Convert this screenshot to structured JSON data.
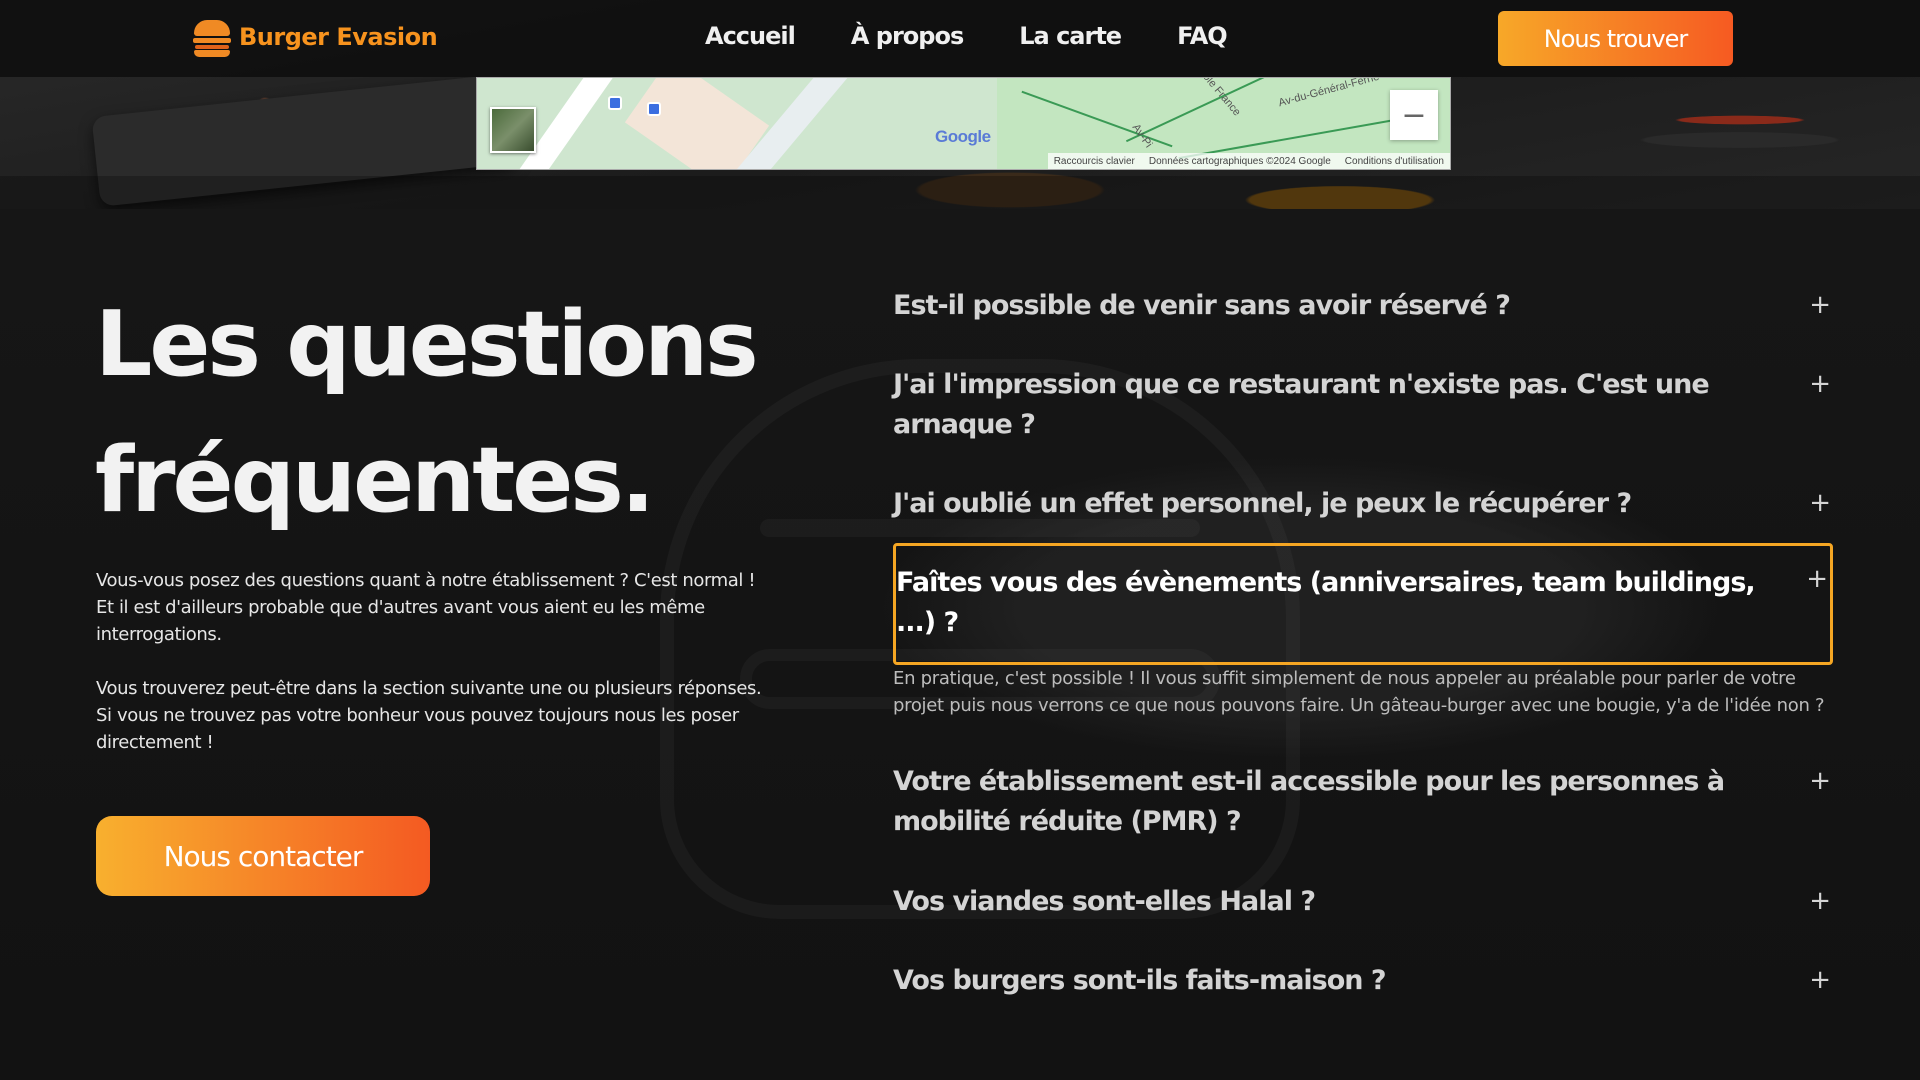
{
  "brand": {
    "name": "Burger Evasion",
    "icon": "burger-icon",
    "color": "#f7931e"
  },
  "nav": {
    "items": [
      {
        "label": "Accueil"
      },
      {
        "label": "À propos"
      },
      {
        "label": "La carte"
      },
      {
        "label": "FAQ"
      }
    ],
    "cta_label": "Nous trouver"
  },
  "map": {
    "logo": "Google",
    "zoom_out": "−",
    "attribution": [
      "Raccourcis clavier",
      "Données cartographiques ©2024 Google",
      "Conditions d'utilisation"
    ],
    "streets": [
      "Av-du-Général-Ferrié",
      "Anatole France",
      "Av-Pi"
    ]
  },
  "section": {
    "title_line1": "Les questions",
    "title_line2": "fréquentes.",
    "intro_p1": "Vous-vous posez des questions quant à notre établissement ? C'est normal ! Et il est d'ailleurs probable que d'autres avant vous aient eu les même interrogations.",
    "intro_p2": "Vous trouverez peut-être dans la section suivante une ou plusieurs réponses. Si vous ne trouvez pas votre bonheur vous pouvez toujours nous les poser directement !",
    "contact_label": "Nous contacter"
  },
  "faq": {
    "plus": "+",
    "items": [
      {
        "question": "Est-il possible de venir sans avoir réservé ?"
      },
      {
        "question": "J'ai l'impression que ce restaurant n'existe pas. C'est une arnaque ?"
      },
      {
        "question": "J'ai oublié un effet personnel, je peux le récupérer ?"
      },
      {
        "question": "Faîtes vous des évènements (anniversaires, team buildings, ...) ?"
      },
      {
        "question": "Votre établissement est-il accessible pour les personnes à mobilité réduite (PMR) ?"
      },
      {
        "question": "Vos viandes sont-elles Halal ?"
      },
      {
        "question": "Vos burgers sont-ils faits-maison ?"
      }
    ],
    "open_answer": "En pratique, c'est possible ! Il vous suffit simplement de nous appeler au préalable pour parler de votre projet puis nous verrons ce que nous pouvons faire. Un gâteau-burger avec une bougie, y'a de l'idée non ?"
  },
  "colors": {
    "accent_start": "#f7a828",
    "accent_end": "#f65a22",
    "focus_border": "#f5a623",
    "background": "#151515"
  }
}
